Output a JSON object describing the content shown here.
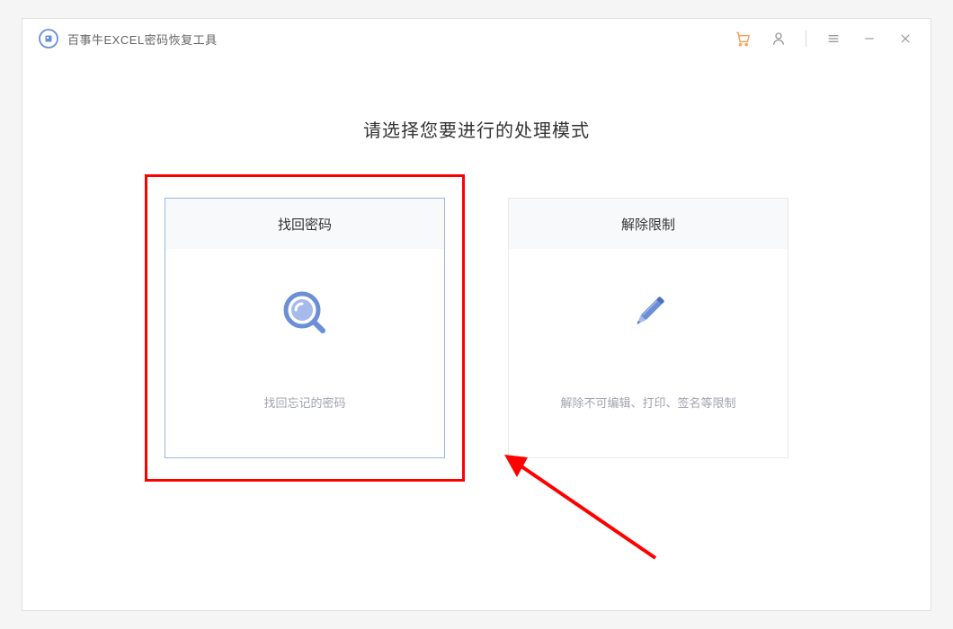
{
  "app": {
    "title": "百事牛EXCEL密码恢复工具"
  },
  "main": {
    "heading": "请选择您要进行的处理模式"
  },
  "cards": {
    "recover": {
      "title": "找回密码",
      "desc": "找回忘记的密码"
    },
    "unlock": {
      "title": "解除限制",
      "desc": "解除不可编辑、打印、签名等限制"
    }
  }
}
